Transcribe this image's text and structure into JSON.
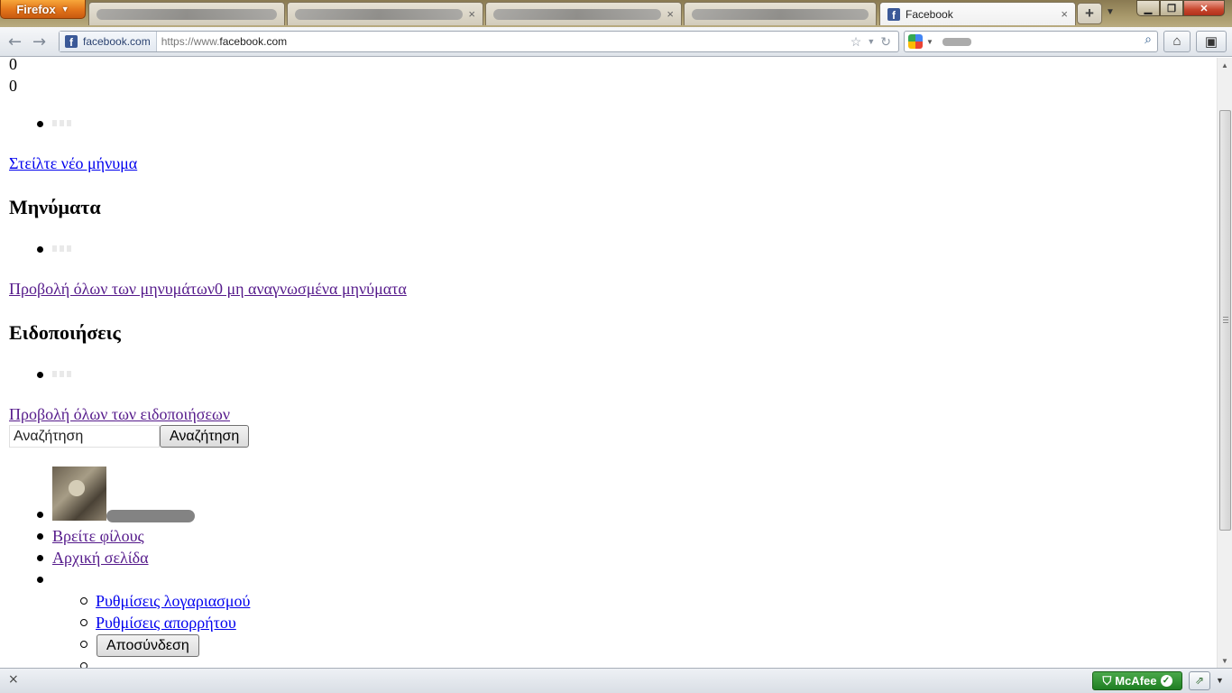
{
  "browser": {
    "menu_label": "Firefox",
    "tabs": [
      {
        "title": ""
      },
      {
        "title": ""
      },
      {
        "title": ""
      },
      {
        "title": ""
      },
      {
        "title": "Facebook"
      }
    ],
    "new_tab": "+",
    "url_identity": "facebook.com",
    "url_prefix": "https://www.",
    "url_domain": "facebook.com",
    "addon_mcafee": "McAfee"
  },
  "page": {
    "counter_1": "0",
    "counter_2": "0",
    "send_new_message": "Στείλτε νέο μήνυμα",
    "messages_heading": "Μηνύματα",
    "view_all_messages": "Προβολή όλων των μηνυμάτων",
    "unread_messages": "0 μη αναγνωσμένα μηνύματα",
    "notifications_heading": "Ειδοποιήσεις",
    "view_all_notifications": "Προβολή όλων των ειδοποιήσεων",
    "search_value": "Αναζήτηση",
    "search_button": "Αναζήτηση",
    "find_friends": "Βρείτε φίλους",
    "home": "Αρχική σελίδα",
    "account_settings": "Ρυθμίσεις λογαριασμού",
    "privacy_settings": "Ρυθμίσεις απορρήτου",
    "logout": "Αποσύνδεση"
  }
}
